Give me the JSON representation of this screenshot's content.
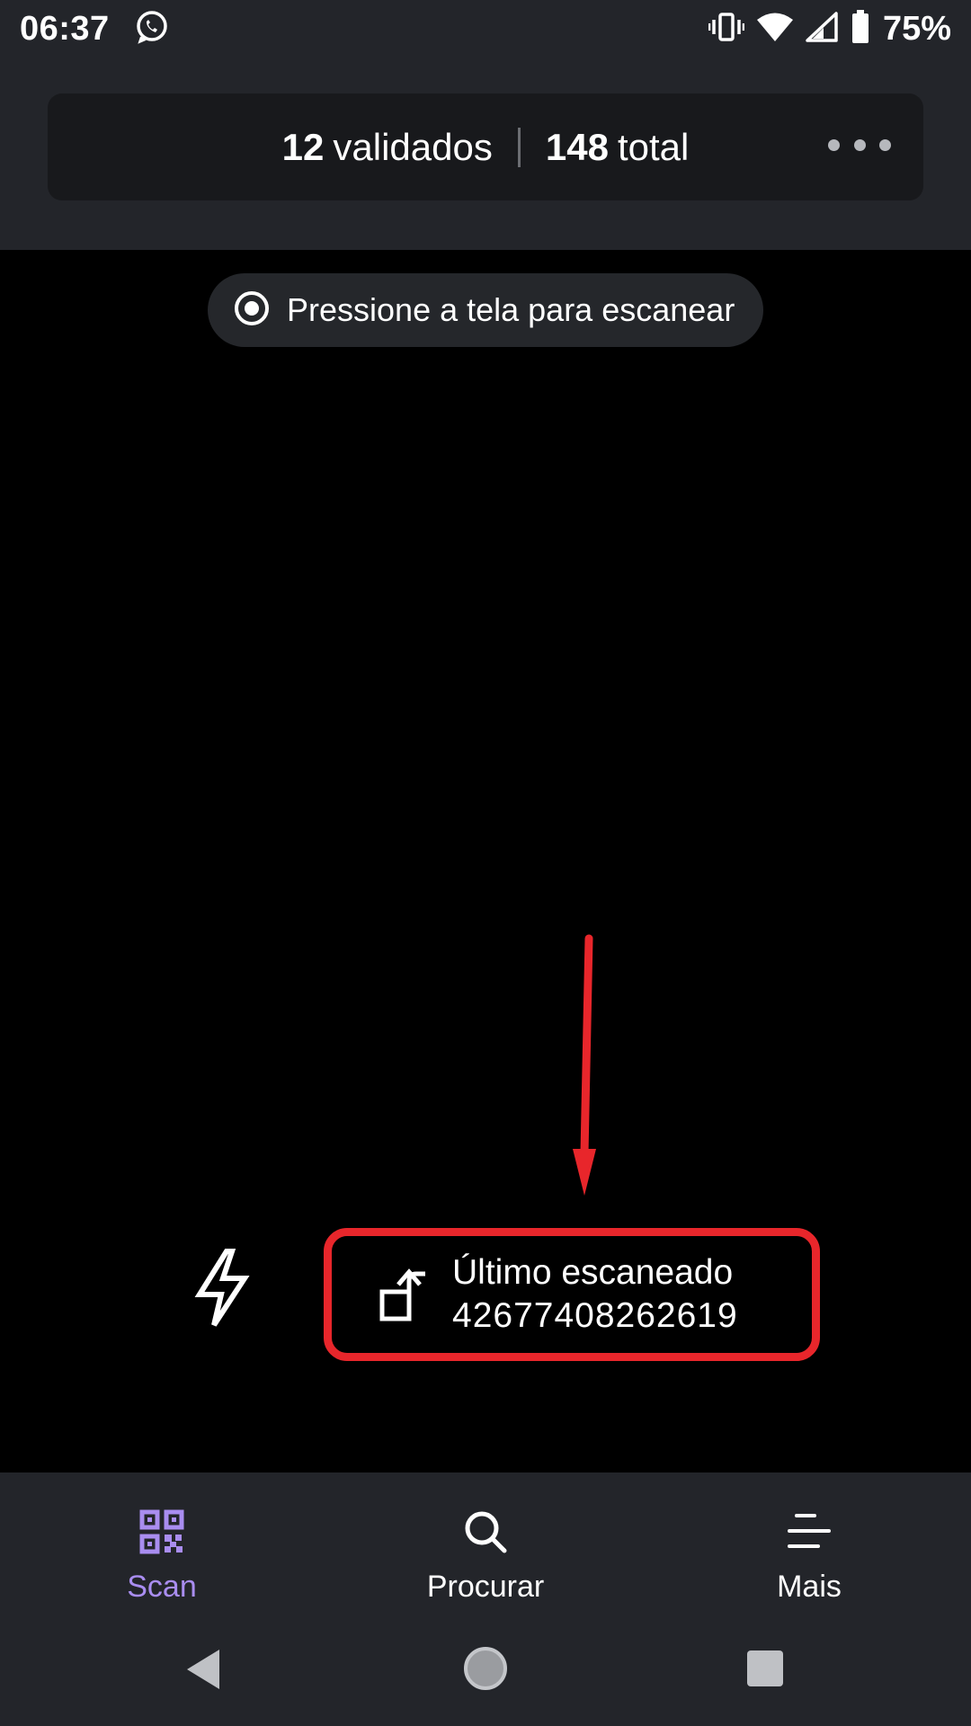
{
  "status_bar": {
    "time": "06:37",
    "notification_icon": "whatsapp-icon",
    "battery_percent": "75%",
    "icons": [
      "vibrate-icon",
      "wifi-icon",
      "cell-signal-icon",
      "battery-icon"
    ]
  },
  "header": {
    "validated_count": "12",
    "validated_label": "validados",
    "total_count": "148",
    "total_label": "total",
    "more_icon": "more-horizontal-icon"
  },
  "camera": {
    "hint_text": "Pressione a tela para escanear",
    "hint_icon": "target-icon",
    "flash_icon": "flash-icon",
    "last_scanned_title": "Último escaneado",
    "last_scanned_code": "42677408262619",
    "last_scanned_icon": "rotate-left-icon",
    "highlight_color": "#e8262b"
  },
  "bottom_nav": {
    "items": [
      {
        "label": "Scan",
        "icon": "qr-code-icon",
        "active": true
      },
      {
        "label": "Procurar",
        "icon": "search-icon",
        "active": false
      },
      {
        "label": "Mais",
        "icon": "menu-icon",
        "active": false
      }
    ],
    "active_color": "#a98df0"
  },
  "system_nav": {
    "buttons": [
      "back-icon",
      "home-icon",
      "recents-icon"
    ]
  }
}
